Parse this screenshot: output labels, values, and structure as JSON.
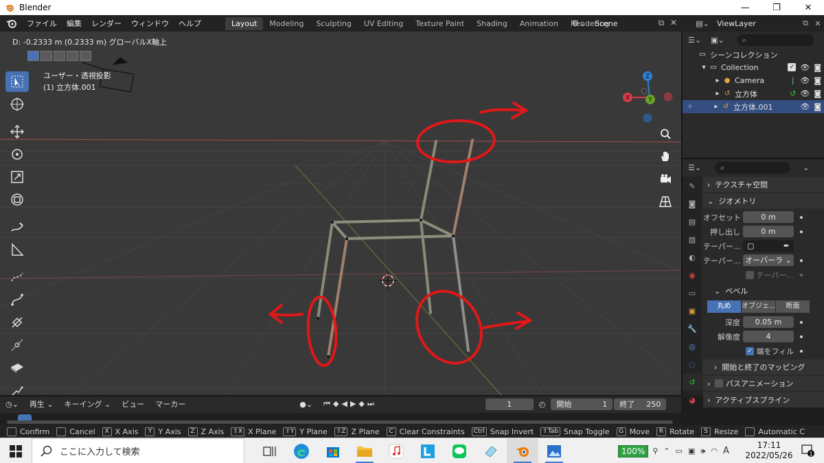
{
  "window": {
    "title": "Blender",
    "minimize": "—",
    "maximize": "❐",
    "close": "✕"
  },
  "menubar": {
    "items": [
      "ファイル",
      "編集",
      "レンダー",
      "ウィンドウ",
      "ヘルプ"
    ],
    "workspaces": [
      "Layout",
      "Modeling",
      "Sculpting",
      "UV Editing",
      "Texture Paint",
      "Shading",
      "Animation",
      "Rendering"
    ],
    "active_workspace": "Layout",
    "scene": "Scene",
    "view_layer": "ViewLayer"
  },
  "viewport": {
    "status": "D: -0.2333 m (0.2333 m) グローバルX軸上",
    "view_name": "ユーザー・透視投影",
    "object_name": "(1) 立方体.001",
    "gizmo": {
      "x": "X",
      "y": "Y",
      "z": "Z"
    }
  },
  "outliner": {
    "root": "シーンコレクション",
    "collection": "Collection",
    "items": [
      {
        "name": "Camera",
        "icon": "camera-icon",
        "selected": false
      },
      {
        "name": "立方体",
        "icon": "curve-icon",
        "selected": false
      },
      {
        "name": "立方体.001",
        "icon": "curve-icon",
        "selected": true
      }
    ]
  },
  "properties": {
    "texture_space": "テクスチャ空間",
    "geometry": "ジオメトリ",
    "offset_label": "オフセット",
    "offset_value": "0 m",
    "extrude_label": "押し出し",
    "extrude_value": "0 m",
    "taper_label": "テーパー...",
    "taper_mode_label": "テーパー...",
    "taper_mode_value": "オーバーラ",
    "taper_radius_label": "テーパー...",
    "bevel": "ベベル",
    "bevel_modes": [
      "丸め",
      "オブジェ...",
      "断面"
    ],
    "bevel_active": "丸め",
    "depth_label": "深度",
    "depth_value": "0.05 m",
    "resolution_label": "解像度",
    "resolution_value": "4",
    "fill_caps_label": "端をフィル",
    "start_end_mapping": "開始と終了のマッピング",
    "path_animation": "パスアニメーション",
    "active_spline": "アクティブスプライン"
  },
  "timeline": {
    "playback": "再生",
    "keying": "キーイング",
    "view": "ビュー",
    "marker": "マーカー",
    "current_frame": "1",
    "start_label": "開始",
    "start_value": "1",
    "end_label": "終了",
    "end_value": "250"
  },
  "statusbar": [
    {
      "key": "",
      "label": "Confirm"
    },
    {
      "key": "",
      "label": "Cancel"
    },
    {
      "key": "X",
      "label": "X Axis"
    },
    {
      "key": "Y",
      "label": "Y Axis"
    },
    {
      "key": "Z",
      "label": "Z Axis"
    },
    {
      "key": "⇧X",
      "label": "X Plane"
    },
    {
      "key": "⇧Y",
      "label": "Y Plane"
    },
    {
      "key": "⇧Z",
      "label": "Z Plane"
    },
    {
      "key": "C",
      "label": "Clear Constraints"
    },
    {
      "key": "Ctrl",
      "label": "Snap Invert"
    },
    {
      "key": "⇧Tab",
      "label": "Snap Toggle"
    },
    {
      "key": "G",
      "label": "Move"
    },
    {
      "key": "R",
      "label": "Rotate"
    },
    {
      "key": "S",
      "label": "Resize"
    },
    {
      "key": "",
      "label": "Automatic C"
    }
  ],
  "taskbar": {
    "search_placeholder": "ここに入力して検索",
    "battery": "100%",
    "time": "17:11",
    "date": "2022/05/26",
    "notifications": "1"
  },
  "colors": {
    "accent": "#4772b3",
    "annotation": "#e01818",
    "viewport_bg": "#393939",
    "panel_bg": "#2a2a2a"
  }
}
